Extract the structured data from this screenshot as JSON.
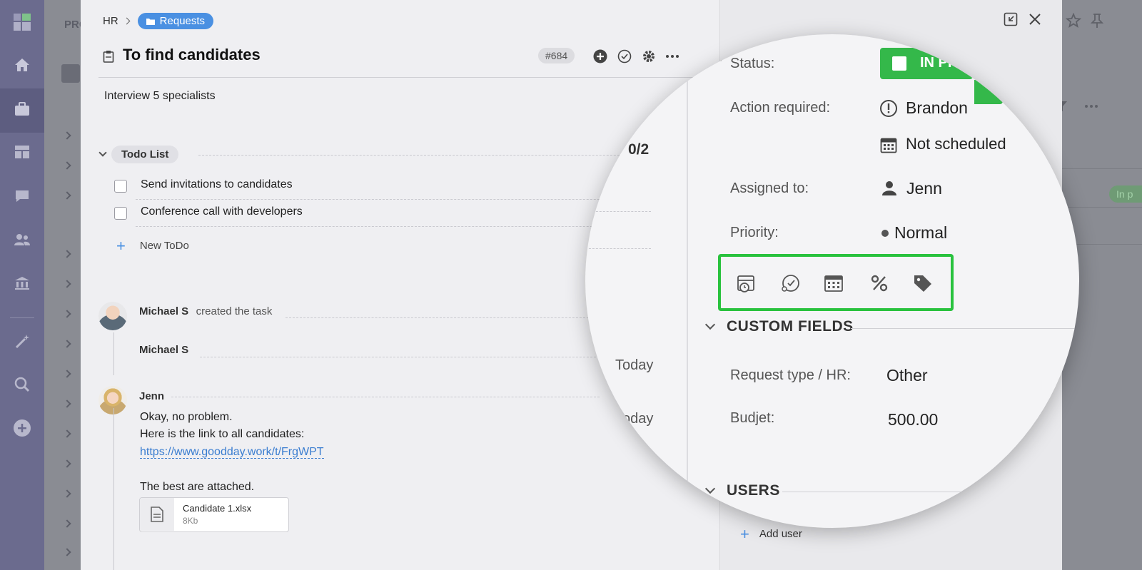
{
  "sidebar": {
    "items": [
      "logo-icon",
      "home-icon",
      "briefcase-icon",
      "dashboard-icon",
      "chat-icon",
      "users-icon",
      "bank-icon",
      "magic-wand-icon",
      "search-icon",
      "plus-circle-icon"
    ]
  },
  "background": {
    "project_label": "PRO",
    "right_status_pill": "In p"
  },
  "task": {
    "breadcrumb": {
      "root": "HR",
      "folder": "Requests"
    },
    "title": "To find candidates",
    "number": "#684",
    "description": "Interview 5 specialists"
  },
  "todo": {
    "title": "Todo List",
    "progress": "0/2",
    "items": [
      {
        "label": "Send invitations to candidates",
        "checked": false
      },
      {
        "label": "Conference call with developers",
        "checked": false
      }
    ],
    "new_label": "New ToDo"
  },
  "activity": {
    "created": {
      "author": "Michael S",
      "text": "created the task"
    },
    "reply_author": "Michael S",
    "message": {
      "author": "Jenn",
      "lines": [
        "Okay, no problem.",
        "Here is the link to all candidates:"
      ],
      "link": "https://www.goodday.work/t/FrgWPT",
      "closing": "The best are attached."
    },
    "attachment": {
      "name": "Candidate 1.xlsx",
      "size": "8Kb"
    },
    "today_1": "Today",
    "today_2": "oday"
  },
  "details": {
    "status_label": "Status:",
    "status_value": "IN PR",
    "action_label": "Action required:",
    "action_value": "Brandon",
    "schedule_value": "Not scheduled",
    "assigned_label": "Assigned to:",
    "assigned_value": "Jenn",
    "priority_label": "Priority:",
    "priority_value": "Normal",
    "tools": [
      "deadline-icon",
      "estimate-icon",
      "calendar-icon",
      "percent-icon",
      "tag-icon"
    ],
    "custom_fields_title": "CUSTOM FIELDS",
    "request_type_label": "Request type / HR:",
    "request_type_value": "Other",
    "budget_label": "Budjet:",
    "budget_value": "500.00",
    "users_title": "USERS",
    "add_user_label": "Add user"
  },
  "colors": {
    "accent": "#4a90e2",
    "status_green": "#34b84a",
    "highlight": "#29c23e",
    "sidebar": "#6b6b8e"
  }
}
